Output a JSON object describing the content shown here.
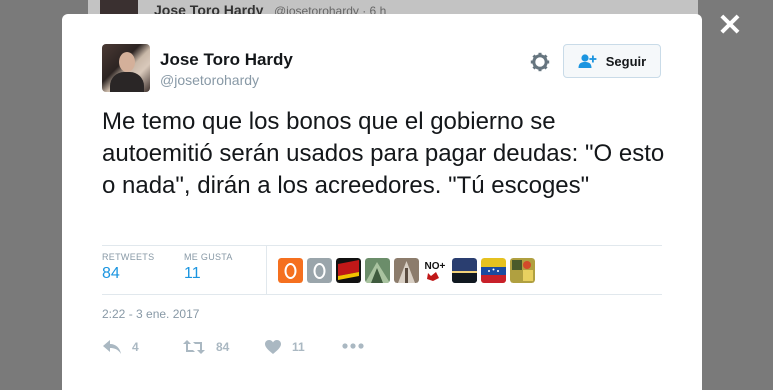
{
  "background": {
    "name": "Jose Toro Hardy",
    "handle": "@josetorohardy · 6 h"
  },
  "close_icon": "✕",
  "tweet": {
    "author_name": "Jose Toro Hardy",
    "author_handle": "@josetorohardy",
    "follow_label": "Seguir",
    "text": "Me temo que los bonos que el gobierno se autoemitió serán usados para pagar deudas: \"O esto o nada\",  dirán a los acreedores. \"Tú escoges\"",
    "retweets_label": "RETWEETS",
    "retweets_count": "84",
    "likes_label": "ME GUSTA",
    "likes_count": "11",
    "liker_avatars": [
      {
        "name": "orange-egg",
        "color": "#f5701f"
      },
      {
        "name": "grey-egg",
        "color": "#9aa5ab"
      },
      {
        "name": "red-flag",
        "color": "#c01818"
      },
      {
        "name": "green-landscape",
        "color": "#6b8d6a"
      },
      {
        "name": "church-photo",
        "color": "#8c7c6c"
      },
      {
        "name": "nomas-logo",
        "color": "#ffffff"
      },
      {
        "name": "night-sky",
        "color": "#2a3e70"
      },
      {
        "name": "venezuela-flag",
        "color": "#e5c120"
      },
      {
        "name": "yellow-collage",
        "color": "#b0a040"
      }
    ],
    "nomas_text": "NO+",
    "date": "2:22 - 3 ene. 2017",
    "reply_count": "4",
    "retweet_action_count": "84",
    "like_action_count": "11"
  }
}
